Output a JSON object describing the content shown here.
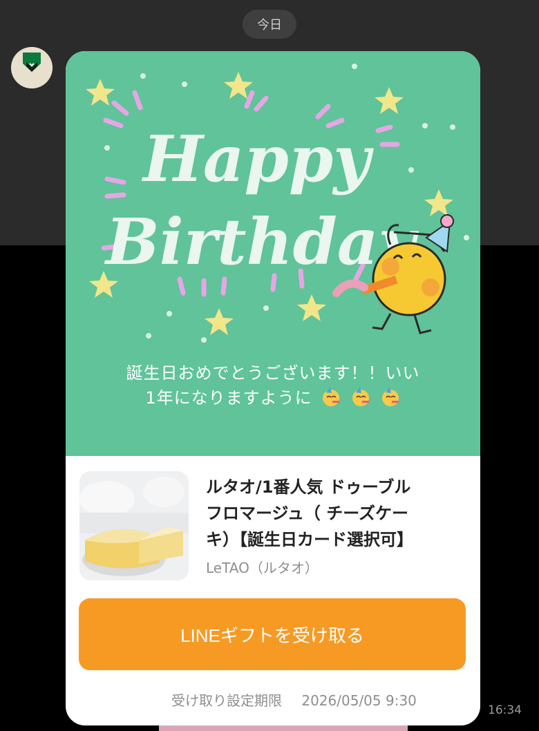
{
  "date_label": "今日",
  "card": {
    "art_line1": "Happy",
    "art_line2": "Birthday",
    "message_line1": "誕生日おめでとうございます！！いい",
    "message_line2": "1年になりますように"
  },
  "product": {
    "title_line1": "ルタオ/1番人気 ドゥーブル",
    "title_line2": "フロマージュ（ チーズケー",
    "title_line3": "キ）【誕生日カード選択可】",
    "brand": "LeTAO（ルタオ）"
  },
  "gift_button_label": "LINEギフトを受け取る",
  "deadline": {
    "label": "受け取り設定期限",
    "value": "2026/05/05 9:30"
  },
  "sent_time": "16:34",
  "colors": {
    "card_green": "#60c39a",
    "button_orange": "#f79a24"
  }
}
